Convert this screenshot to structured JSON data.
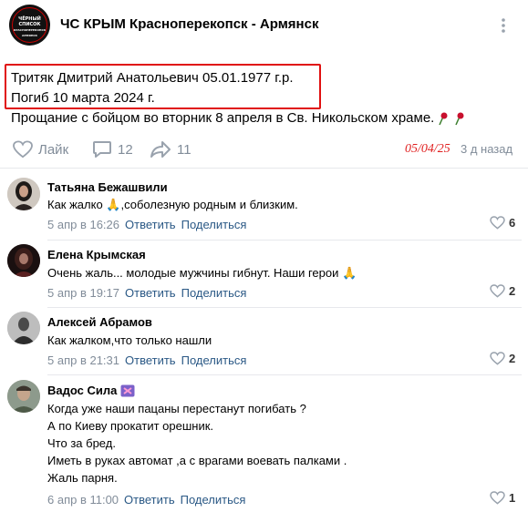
{
  "header": {
    "group_name": "ЧС КРЫМ Красноперекопск - Армянск",
    "logo_text": [
      "ЧЁРНЫЙ",
      "СПИСОК",
      "КРАСНОПЕРЕКОПСК",
      "АРМЯНСК"
    ]
  },
  "post": {
    "line1": "Тритяк Дмитрий Анатольевич 05.01.1977 г.р.",
    "line2": "Погиб 10 марта 2024 г.",
    "line3": "Прощание с бойцом во вторник 8 апреля в Св. Никольском храме.",
    "like_label": "Лайк",
    "comments_count": "12",
    "shares_count": "11",
    "handwritten_date": "05/04/25",
    "time_ago": "3 д назад"
  },
  "comments": [
    {
      "author": "Татьяна Бежашвили",
      "lines": [
        "Как жалко 🙏,соболезную родным и близким."
      ],
      "date": "5 апр в 16:26",
      "reply": "Ответить",
      "share": "Поделиться",
      "likes": "6"
    },
    {
      "author": "Елена Крымская",
      "lines": [
        "Очень жаль... молодые мужчины гибнут. Наши герои 🙏"
      ],
      "date": "5 апр в 19:17",
      "reply": "Ответить",
      "share": "Поделиться",
      "likes": "2"
    },
    {
      "author": "Алексей Абрамов",
      "lines": [
        "Как жалком,что только нашли"
      ],
      "date": "5 апр в 21:31",
      "reply": "Ответить",
      "share": "Поделиться",
      "likes": "2"
    },
    {
      "author": "Вадос Сила",
      "lines": [
        "Когда уже наши пацаны перестанут погибать ?",
        "А по Киеву прокатит орешник.",
        "Что за бред.",
        "Иметь в руках автомат ,а с врагами воевать палками .",
        "Жаль парня."
      ],
      "date": "6 апр в 11:00",
      "reply": "Ответить",
      "share": "Поделиться",
      "likes": "1"
    }
  ],
  "colors": {
    "accent_link": "#2a5885",
    "secondary_text": "#818c99",
    "highlight_border": "#e01010",
    "handwritten": "#e02020"
  },
  "icons": [
    "ellipsis-icon",
    "heart-icon",
    "comment-icon",
    "share-icon",
    "rose-icon",
    "badge-icon"
  ]
}
